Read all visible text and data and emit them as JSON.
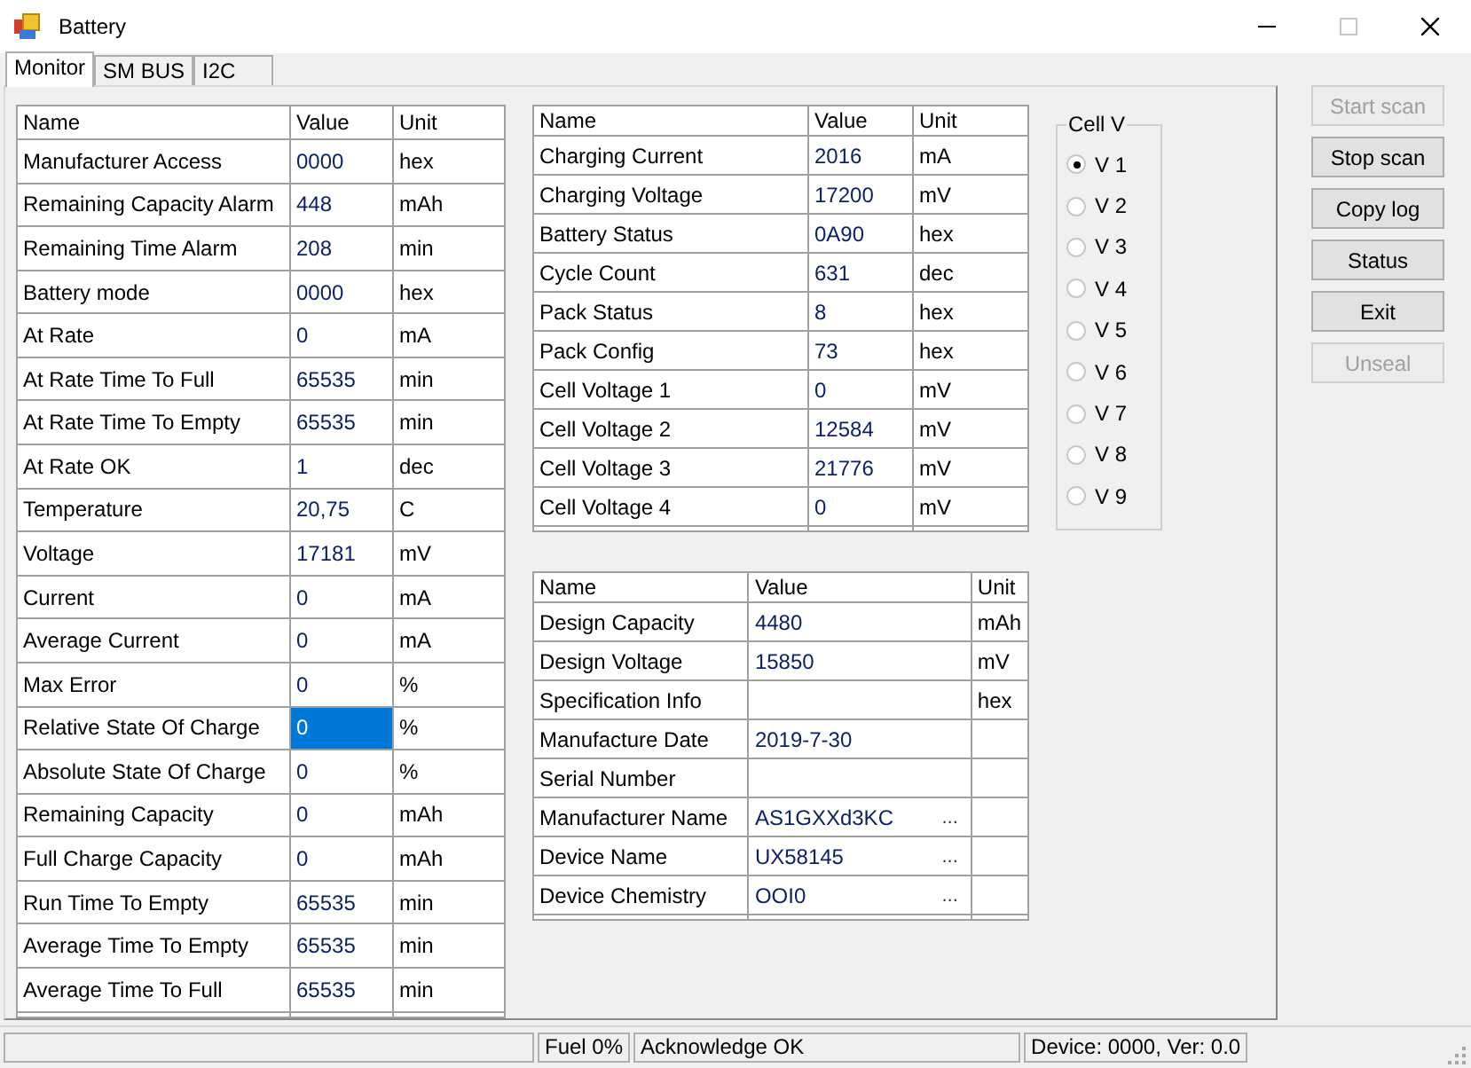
{
  "window": {
    "title": "Battery",
    "controls": [
      {
        "kind": "minimize",
        "disabled": false
      },
      {
        "kind": "maximize",
        "disabled": true
      },
      {
        "kind": "close",
        "disabled": false
      }
    ]
  },
  "tabs": [
    {
      "label": "Monitor",
      "selected": true
    },
    {
      "label": "SM BUS",
      "selected": false
    },
    {
      "label": "I2C",
      "selected": false
    }
  ],
  "main_table": {
    "columns": [
      "Name",
      "Value",
      "Unit"
    ],
    "rows": [
      {
        "name": "Manufacturer Access",
        "value": "0000",
        "unit": "hex",
        "selected": false
      },
      {
        "name": "Remaining Capacity Alarm",
        "value": "448",
        "unit": "mAh",
        "selected": false
      },
      {
        "name": "Remaining Time Alarm",
        "value": "208",
        "unit": "min",
        "selected": false
      },
      {
        "name": "Battery mode",
        "value": "0000",
        "unit": "hex",
        "selected": false
      },
      {
        "name": "At Rate",
        "value": "0",
        "unit": "mA",
        "selected": false
      },
      {
        "name": "At Rate Time To Full",
        "value": "65535",
        "unit": "min",
        "selected": false
      },
      {
        "name": "At Rate Time To Empty",
        "value": "65535",
        "unit": "min",
        "selected": false
      },
      {
        "name": "At Rate OK",
        "value": "1",
        "unit": "dec",
        "selected": false
      },
      {
        "name": "Temperature",
        "value": "20,75",
        "unit": "C",
        "selected": false
      },
      {
        "name": "Voltage",
        "value": "17181",
        "unit": "mV",
        "selected": false
      },
      {
        "name": "Current",
        "value": "0",
        "unit": "mA",
        "selected": false
      },
      {
        "name": "Average Current",
        "value": "0",
        "unit": "mA",
        "selected": false
      },
      {
        "name": "Max Error",
        "value": "0",
        "unit": "%",
        "selected": false
      },
      {
        "name": "Relative State Of Charge",
        "value": "0",
        "unit": "%",
        "selected": true
      },
      {
        "name": "Absolute State Of Charge",
        "value": "0",
        "unit": "%",
        "selected": false
      },
      {
        "name": "Remaining Capacity",
        "value": "0",
        "unit": "mAh",
        "selected": false
      },
      {
        "name": "Full Charge Capacity",
        "value": "0",
        "unit": "mAh",
        "selected": false
      },
      {
        "name": "Run Time To Empty",
        "value": "65535",
        "unit": "min",
        "selected": false
      },
      {
        "name": "Average Time To Empty",
        "value": "65535",
        "unit": "min",
        "selected": false
      },
      {
        "name": "Average Time To Full",
        "value": "65535",
        "unit": "min",
        "selected": false
      }
    ]
  },
  "charging_table": {
    "columns": [
      "Name",
      "Value",
      "Unit"
    ],
    "rows": [
      {
        "name": "Charging Current",
        "value": "2016",
        "unit": "mA"
      },
      {
        "name": "Charging Voltage",
        "value": "17200",
        "unit": "mV"
      },
      {
        "name": "Battery Status",
        "value": "0A90",
        "unit": "hex"
      },
      {
        "name": "Cycle Count",
        "value": "631",
        "unit": "dec"
      },
      {
        "name": "Pack Status",
        "value": "8",
        "unit": "hex"
      },
      {
        "name": "Pack Config",
        "value": "73",
        "unit": "hex"
      },
      {
        "name": "Cell Voltage 1",
        "value": "0",
        "unit": "mV"
      },
      {
        "name": "Cell Voltage 2",
        "value": "12584",
        "unit": "mV"
      },
      {
        "name": "Cell Voltage 3",
        "value": "21776",
        "unit": "mV"
      },
      {
        "name": "Cell Voltage 4",
        "value": "0",
        "unit": "mV"
      }
    ]
  },
  "design_table": {
    "columns": [
      "Name",
      "Value",
      "Unit"
    ],
    "rows": [
      {
        "name": "Design Capacity",
        "value": "4480",
        "unit": "mAh"
      },
      {
        "name": "Design Voltage",
        "value": "15850",
        "unit": "mV"
      },
      {
        "name": "Specification Info",
        "unit": "hex"
      },
      {
        "name": "Manufacture Date",
        "value": "2019-7-30"
      },
      {
        "name": "Serial Number"
      },
      {
        "name": "Manufacturer Name",
        "value": "AS1GXXd3KC",
        "more": "..."
      },
      {
        "name": "Device Name",
        "value": "UX58145",
        "more": "..."
      },
      {
        "name": "Device Chemistry",
        "value": "OOI0",
        "more": "..."
      }
    ]
  },
  "cell_v": {
    "title": "Cell V",
    "options": [
      {
        "label": "V 1",
        "selected": true
      },
      {
        "label": "V 2",
        "selected": false
      },
      {
        "label": "V 3",
        "selected": false
      },
      {
        "label": "V 4",
        "selected": false
      },
      {
        "label": "V 5",
        "selected": false
      },
      {
        "label": "V 6",
        "selected": false
      },
      {
        "label": "V 7",
        "selected": false
      },
      {
        "label": "V 8",
        "selected": false
      },
      {
        "label": "V 9",
        "selected": false
      }
    ]
  },
  "buttons": [
    {
      "label": "Start scan",
      "disabled": true
    },
    {
      "label": "Stop scan",
      "disabled": false
    },
    {
      "label": "Copy log",
      "disabled": false
    },
    {
      "label": "Status",
      "disabled": false
    },
    {
      "label": "Exit",
      "disabled": false
    },
    {
      "label": "Unseal",
      "disabled": true
    }
  ],
  "status_bar": {
    "fuel": "Fuel 0%",
    "message": "Acknowledge OK",
    "device": "Device: 0000, Ver: 0.0"
  }
}
